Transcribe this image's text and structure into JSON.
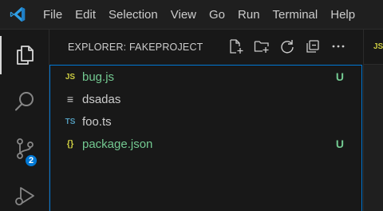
{
  "app": {
    "logo_icon": "vscode-logo-icon",
    "accent": "#0078d4"
  },
  "menu": [
    "File",
    "Edit",
    "Selection",
    "View",
    "Go",
    "Run",
    "Terminal",
    "Help"
  ],
  "activity_bar": {
    "items": [
      {
        "icon": "files-icon",
        "active": true
      },
      {
        "icon": "search-icon",
        "active": false
      },
      {
        "icon": "source-control-icon",
        "active": false,
        "badge": "2"
      },
      {
        "icon": "run-debug-icon",
        "active": false
      }
    ]
  },
  "explorer": {
    "title": "EXPLORER: FAKEPROJECT",
    "actions": [
      "new-file-icon",
      "new-folder-icon",
      "refresh-icon",
      "collapse-all-icon",
      "more-icon"
    ],
    "files": [
      {
        "icon_text": "JS",
        "icon_color": "#cbcb41",
        "name": "bug.js",
        "status": "U",
        "name_color": "#73c991",
        "status_color": "#73c991"
      },
      {
        "icon_text": "≡",
        "icon_color": "#cccccc",
        "name": "dsadas",
        "status": "",
        "name_color": "#cccccc",
        "status_color": "#cccccc"
      },
      {
        "icon_text": "TS",
        "icon_color": "#519aba",
        "name": "foo.ts",
        "status": "",
        "name_color": "#cccccc",
        "status_color": "#cccccc"
      },
      {
        "icon_text": "{}",
        "icon_color": "#cbcb41",
        "name": "package.json",
        "status": "U",
        "name_color": "#73c991",
        "status_color": "#73c991"
      }
    ]
  },
  "editor": {
    "tab_icon_text": "JS"
  }
}
